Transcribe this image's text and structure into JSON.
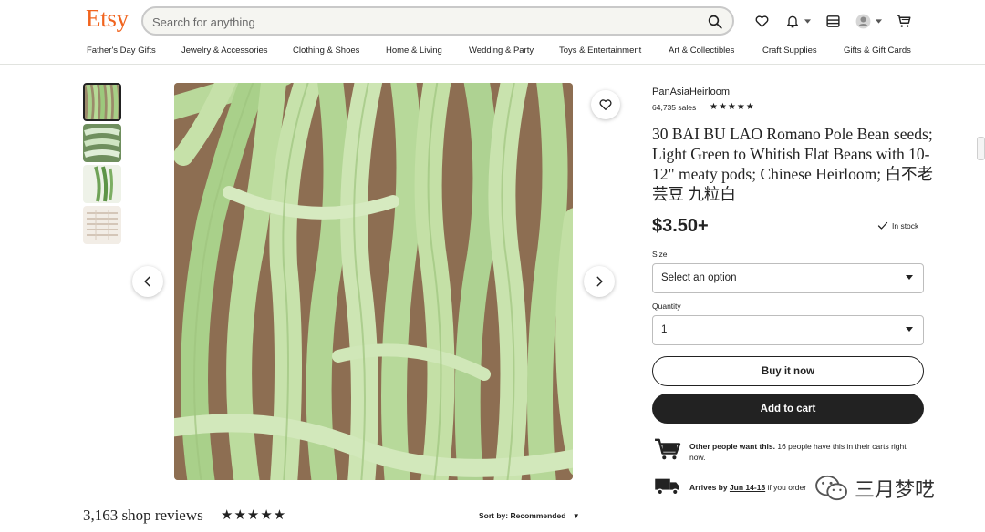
{
  "header": {
    "logo": "Etsy",
    "search_placeholder": "Search for anything",
    "icons": [
      "heart-icon",
      "bell-icon",
      "shop-manager-icon",
      "account-icon",
      "cart-icon"
    ]
  },
  "categories": [
    "Father's Day Gifts",
    "Jewelry & Accessories",
    "Clothing & Shoes",
    "Home & Living",
    "Wedding & Party",
    "Toys & Entertainment",
    "Art & Collectibles",
    "Craft Supplies",
    "Gifts & Gift Cards"
  ],
  "listing": {
    "shop_name": "PanAsiaHeirloom",
    "sales": "64,735 sales",
    "rating_stars": "★★★★★",
    "title": "30 BAI BU LAO Romano Pole Bean seeds; Light Green to Whitish Flat Beans with 10-12\" meaty pods; Chinese Heirloom; 白不老芸豆 九粒白",
    "price": "$3.50+",
    "stock": "In stock",
    "size_label": "Size",
    "size_value": "Select an option",
    "quantity_label": "Quantity",
    "quantity_value": "1",
    "buy_now": "Buy it now",
    "add_to_cart": "Add to cart",
    "demand_bold": "Other people want this.",
    "demand_text": " 16 people have this in their carts right now.",
    "arrives_prefix": "Arrives by ",
    "arrives_date": "Jun 14-18",
    "arrives_suffix": " if you order"
  },
  "reviews": {
    "count": "3,163 shop reviews",
    "stars": "★★★★★",
    "sort_label": "Sort by: ",
    "sort_value": "Recommended"
  },
  "watermark": {
    "text": "三月梦呓"
  },
  "colors": {
    "brand": "#f1641e",
    "text": "#222222",
    "button_dark": "#222222",
    "border": "#bdbdbd"
  }
}
